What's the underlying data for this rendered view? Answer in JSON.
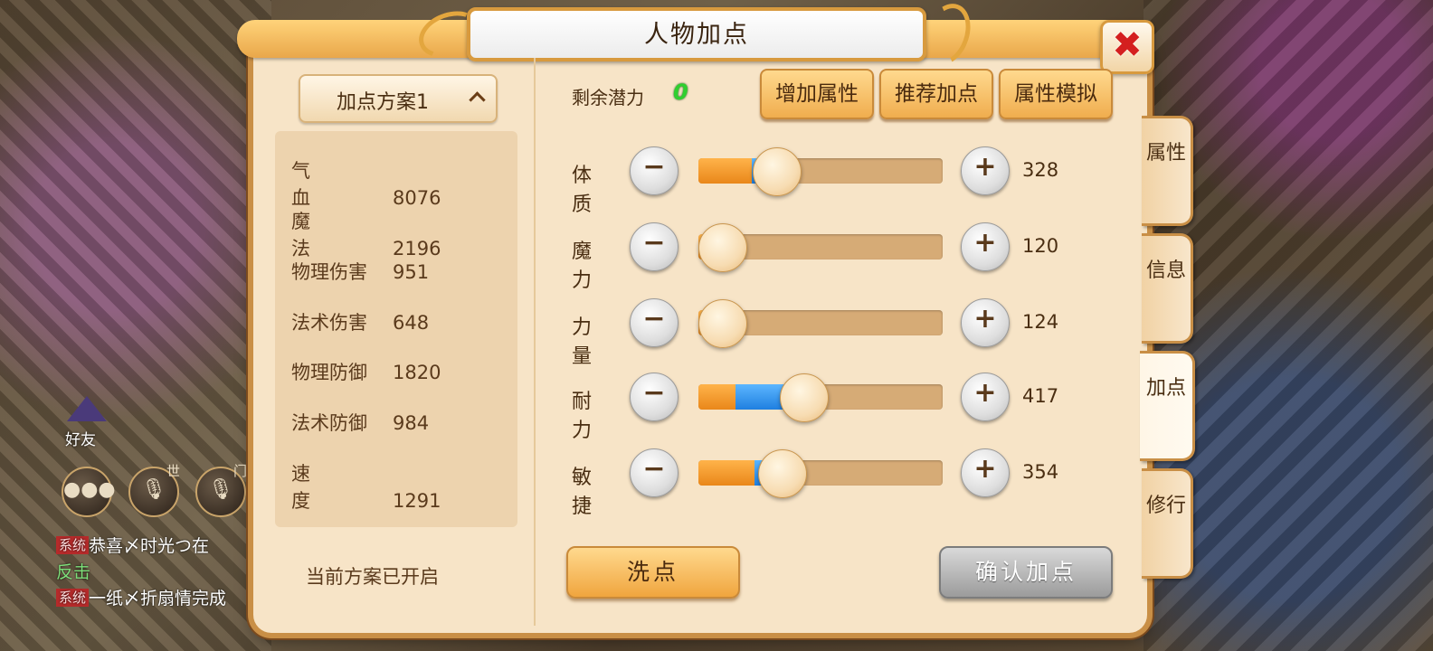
{
  "title": "人物加点",
  "left_panel": {
    "plan_label": "加点方案1",
    "stats": [
      {
        "name": "气血",
        "value": "8076"
      },
      {
        "name": "魔法",
        "value": "2196"
      },
      {
        "name": "物理伤害",
        "value": "951"
      },
      {
        "name": "法术伤害",
        "value": "648"
      },
      {
        "name": "物理防御",
        "value": "1820"
      },
      {
        "name": "法术防御",
        "value": "984"
      },
      {
        "name": "速度",
        "value": "1291"
      }
    ],
    "plan_status": "当前方案已开启"
  },
  "potential": {
    "label": "剩余潜力",
    "value": "0"
  },
  "top_buttons": [
    "增加属性",
    "推荐加点",
    "属性模拟"
  ],
  "attributes": [
    {
      "name": "体质",
      "value": "328",
      "base_fraction": 0.22,
      "added_fraction": 0.1
    },
    {
      "name": "魔力",
      "value": "120",
      "base_fraction": 0.07,
      "added_fraction": 0.0
    },
    {
      "name": "力量",
      "value": "124",
      "base_fraction": 0.07,
      "added_fraction": 0.0
    },
    {
      "name": "耐力",
      "value": "417",
      "base_fraction": 0.15,
      "added_fraction": 0.28
    },
    {
      "name": "敏捷",
      "value": "354",
      "base_fraction": 0.23,
      "added_fraction": 0.11
    }
  ],
  "buttons": {
    "reset": "洗点",
    "confirm": "确认加点"
  },
  "side_tabs": [
    {
      "label": "属性",
      "active": false
    },
    {
      "label": "信息",
      "active": false
    },
    {
      "label": "加点",
      "active": true
    },
    {
      "label": "修行",
      "active": false
    }
  ],
  "hud": {
    "friend_label": "好友",
    "chat_tags": [
      "世",
      "门"
    ],
    "chat_log": [
      {
        "tag": "系统",
        "text": "恭喜〆时光つ在"
      },
      {
        "tag": "",
        "text": "反击"
      },
      {
        "tag": "系统",
        "text": "一纸〆折扇情完成"
      }
    ]
  },
  "colors": {
    "accent": "#f0ad4e",
    "panel_bg": "#f7e4c7",
    "close": "#d41f1f",
    "potential": "#2fcf2f",
    "added_points": "#1f7fe0"
  },
  "icons": {
    "close": "close-icon",
    "minus": "minus-icon",
    "plus": "plus-icon",
    "chat": "chat-bubble-icon",
    "voice": "microphone-icon",
    "expand": "chevron-up-icon"
  }
}
